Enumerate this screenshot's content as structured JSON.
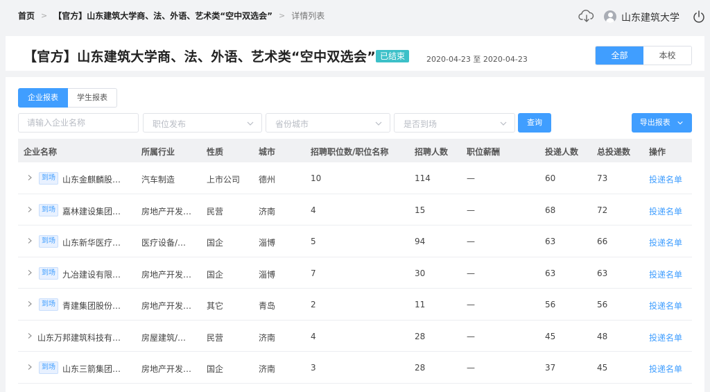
{
  "breadcrumb": {
    "home": "首页",
    "current": "【官方】山东建筑大学商、法、外语、艺术类“空中双选会”",
    "last": "详情列表"
  },
  "user": {
    "name": "山东建筑大学"
  },
  "header": {
    "title": "【官方】山东建筑大学商、法、外语、艺术类“空中双选会”",
    "status": "已结束",
    "date_range": "2020-04-23 至 2020-04-23",
    "scope_options": [
      "全部",
      "本校"
    ],
    "scope_selected": "全部"
  },
  "tabs": [
    "企业报表",
    "学生报表"
  ],
  "filters": {
    "company_placeholder": "请输入企业名称",
    "position_placeholder": "职位发布",
    "city_placeholder": "省份城市",
    "arrival_placeholder": "是否到场",
    "query_label": "查询",
    "export_label": "导出报表"
  },
  "table": {
    "columns": [
      "企业名称",
      "所属行业",
      "性质",
      "城市",
      "招聘职位数/职位名称",
      "招聘人数",
      "职位薪酬",
      "投递人数",
      "总投递数",
      "操作"
    ],
    "rows": [
      {
        "tag": "到场",
        "name": "山东金麒麟股…",
        "industry": "汽车制造",
        "nature": "上市公司",
        "city": "德州",
        "positions": "10",
        "headcount": "114",
        "salary": "—",
        "applicants": "60",
        "total": "73",
        "action": "投递名单"
      },
      {
        "tag": "到场",
        "name": "嘉林建设集团…",
        "industry": "房地产开发…",
        "nature": "民营",
        "city": "济南",
        "positions": "4",
        "headcount": "15",
        "salary": "—",
        "applicants": "68",
        "total": "72",
        "action": "投递名单"
      },
      {
        "tag": "到场",
        "name": "山东新华医疗…",
        "industry": "医疗设备/…",
        "nature": "国企",
        "city": "淄博",
        "positions": "5",
        "headcount": "94",
        "salary": "—",
        "applicants": "63",
        "total": "66",
        "action": "投递名单"
      },
      {
        "tag": "到场",
        "name": "九冶建设有限…",
        "industry": "房地产开发…",
        "nature": "国企",
        "city": "淄博",
        "positions": "7",
        "headcount": "30",
        "salary": "—",
        "applicants": "63",
        "total": "63",
        "action": "投递名单"
      },
      {
        "tag": "到场",
        "name": "青建集团股份…",
        "industry": "房地产开发…",
        "nature": "其它",
        "city": "青岛",
        "positions": "2",
        "headcount": "11",
        "salary": "—",
        "applicants": "56",
        "total": "56",
        "action": "投递名单"
      },
      {
        "tag": "",
        "name": "山东万邦建筑科技有…",
        "industry": "房屋建筑/…",
        "nature": "民营",
        "city": "济南",
        "positions": "4",
        "headcount": "28",
        "salary": "—",
        "applicants": "45",
        "total": "48",
        "action": "投递名单"
      },
      {
        "tag": "到场",
        "name": "山东三箭集团…",
        "industry": "房地产开发…",
        "nature": "国企",
        "city": "济南",
        "positions": "3",
        "headcount": "28",
        "salary": "—",
        "applicants": "37",
        "total": "45",
        "action": "投递名单"
      }
    ]
  }
}
